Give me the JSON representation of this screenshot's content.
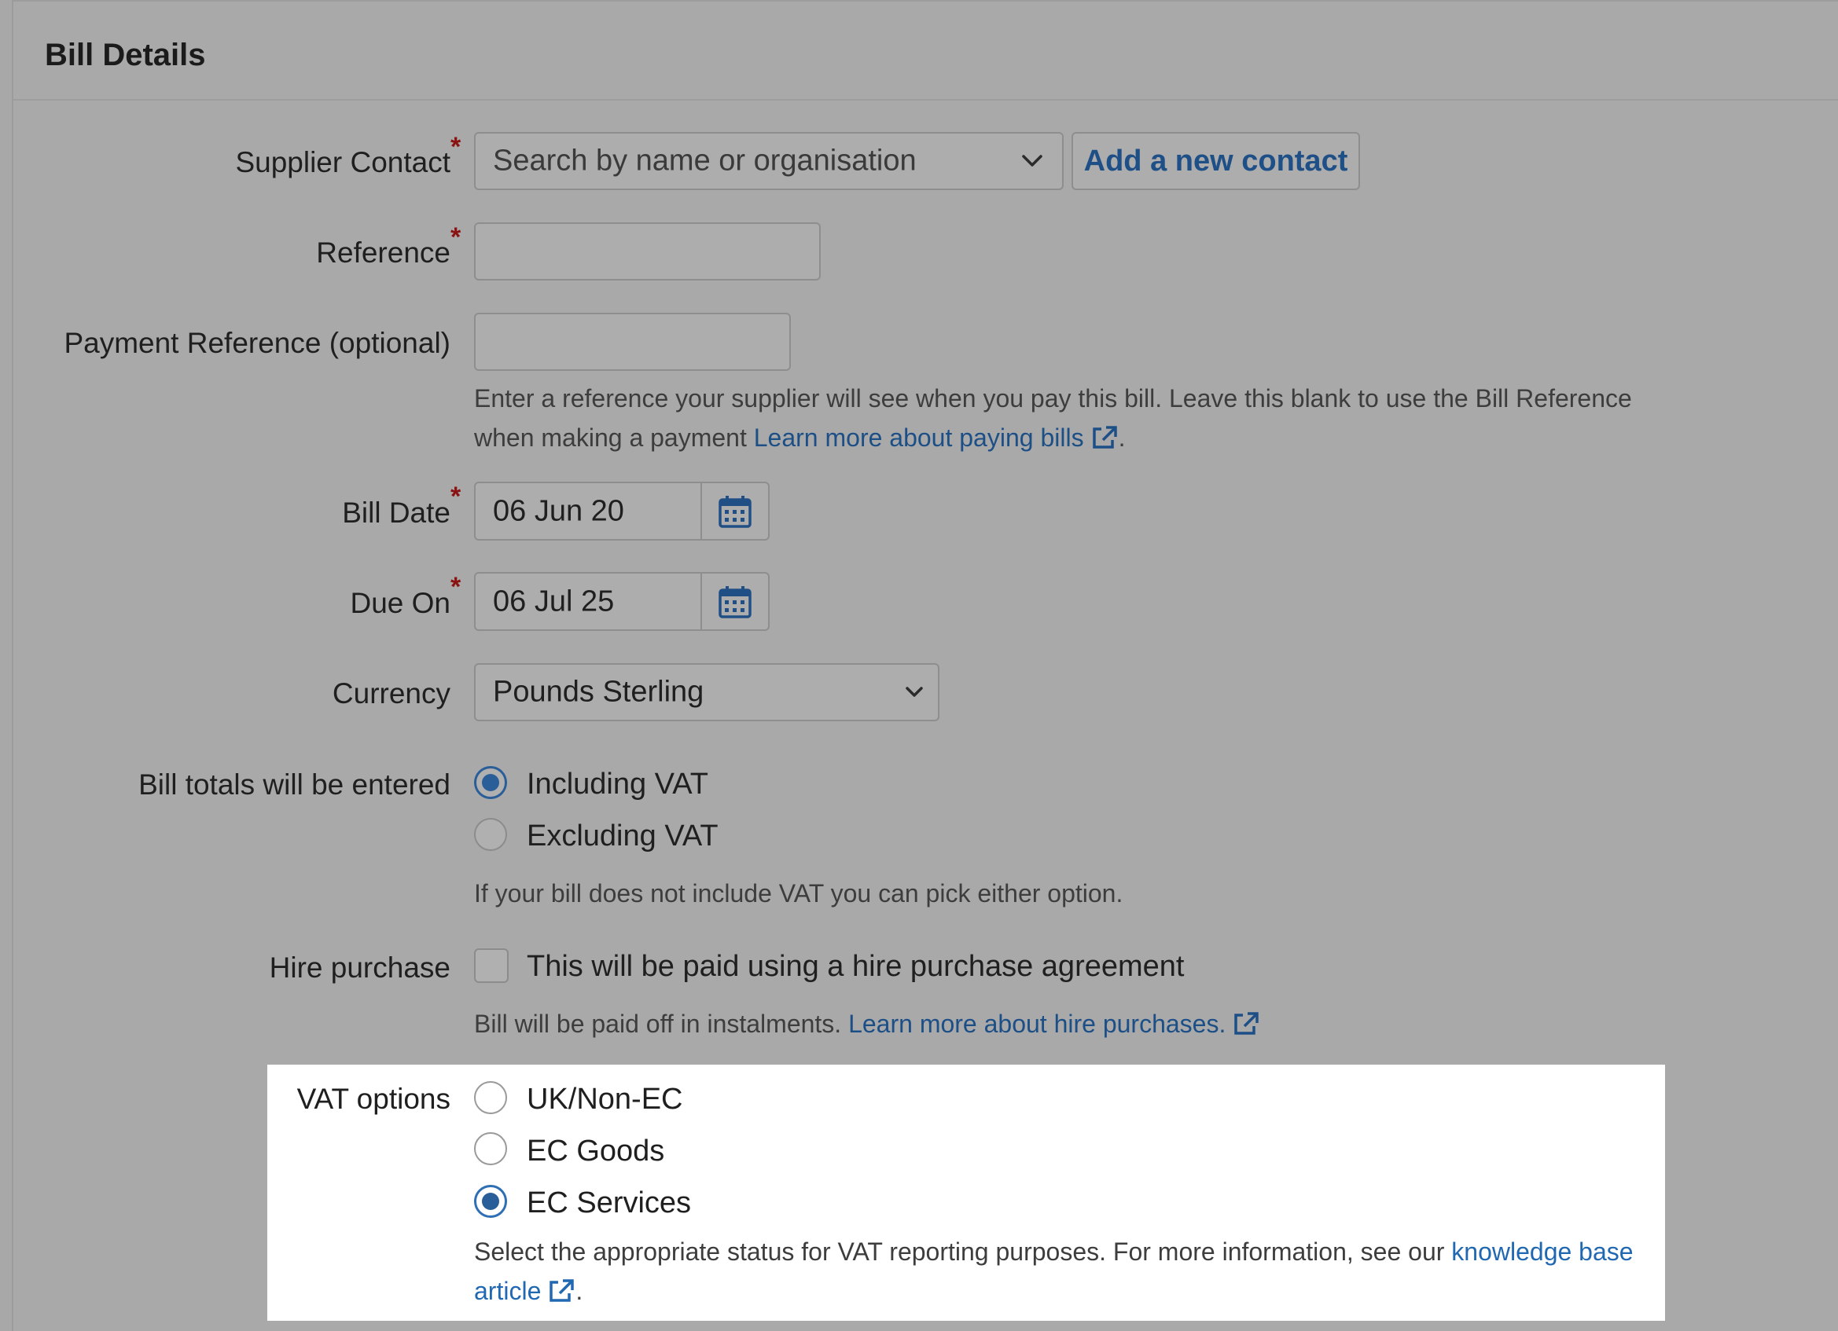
{
  "panel": {
    "title": "Bill Details"
  },
  "form": {
    "supplier_contact": {
      "label": "Supplier Contact",
      "required": "*",
      "placeholder": "Search by name or organisation",
      "add_button": "Add a new contact"
    },
    "reference": {
      "label": "Reference",
      "required": "*",
      "value": ""
    },
    "payment_reference": {
      "label": "Payment Reference (optional)",
      "value": "",
      "help_text": "Enter a reference your supplier will see when you pay this bill. Leave this blank to use the Bill Reference",
      "help_text_2": "when making a payment",
      "help_link": "Learn more about paying bills",
      "help_end": "."
    },
    "bill_date": {
      "label": "Bill Date",
      "required": "*",
      "value": "06 Jun 20"
    },
    "due_on": {
      "label": "Due On",
      "required": "*",
      "value": "06 Jul 25"
    },
    "currency": {
      "label": "Currency",
      "value": "Pounds Sterling"
    },
    "bill_totals": {
      "label": "Bill totals will be entered",
      "options": [
        "Including VAT",
        "Excluding VAT"
      ],
      "selected": "Including VAT",
      "help_text": "If your bill does not include VAT you can pick either option."
    },
    "hire_purchase": {
      "label": "Hire purchase",
      "checkbox_label": "This will be paid using a hire purchase agreement",
      "checked": false,
      "help_text": "Bill will be paid off in instalments.",
      "help_link": "Learn more about hire purchases."
    },
    "vat_options": {
      "label": "VAT options",
      "options": [
        "UK/Non-EC",
        "EC Goods",
        "EC Services"
      ],
      "selected": "EC Services",
      "help_text": "Select the appropriate status for VAT reporting purposes. For more information, see our",
      "help_link": "knowledge base",
      "help_link_2": "article",
      "help_end": "."
    }
  },
  "colors": {
    "accent": "#2a5e98",
    "link": "#1d4f87",
    "required": "#8a1212",
    "highlight_bg": "#ffffff"
  },
  "icons": {
    "calendar": "calendar-icon",
    "chevron": "chevron-down-icon",
    "external": "external-link-icon"
  }
}
